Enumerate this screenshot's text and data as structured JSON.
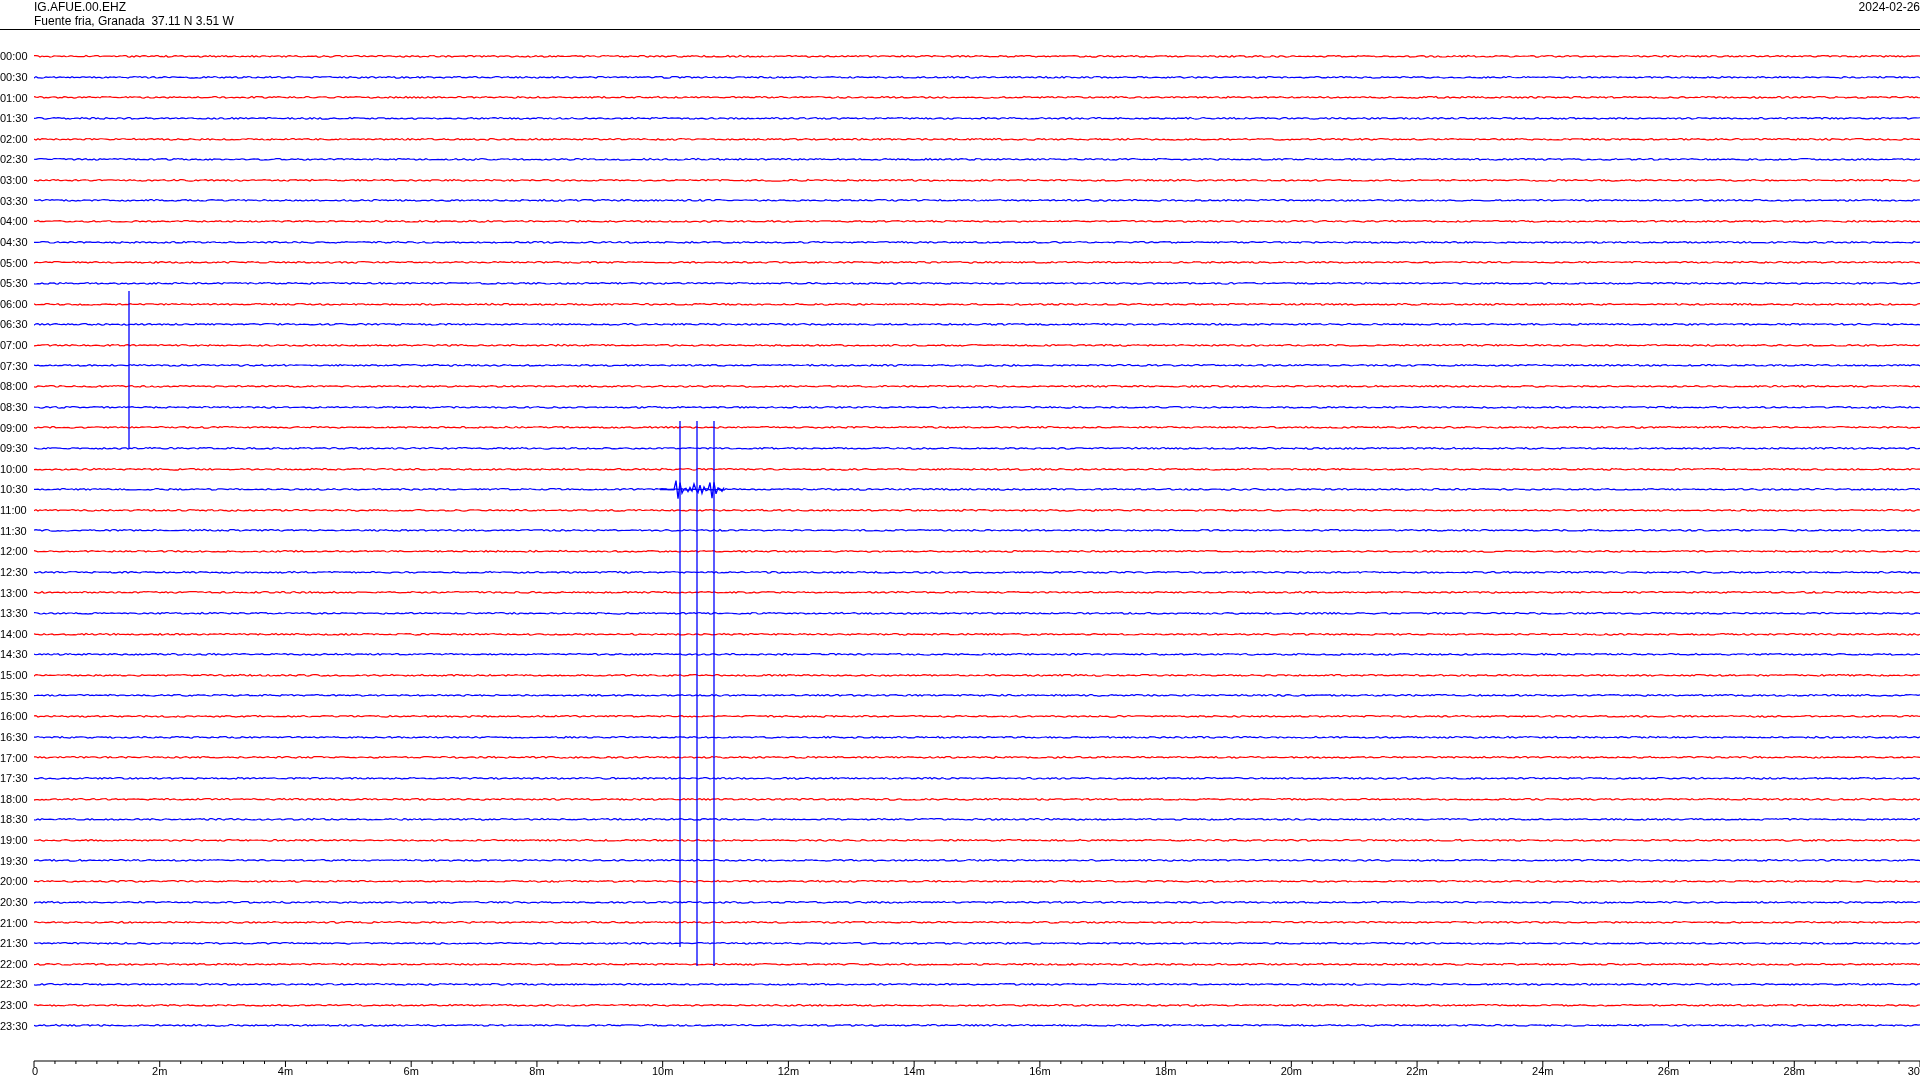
{
  "header": {
    "station": "IG.AFUE.00.EHZ",
    "location": "Fuente fria, Granada  37.11 N 3.51 W",
    "date": "2024-02-26"
  },
  "rows": [
    {
      "time": "00:00",
      "color": "#ff0000"
    },
    {
      "time": "00:30",
      "color": "#0000ff"
    },
    {
      "time": "01:00",
      "color": "#ff0000"
    },
    {
      "time": "01:30",
      "color": "#0000ff"
    },
    {
      "time": "02:00",
      "color": "#ff0000"
    },
    {
      "time": "02:30",
      "color": "#0000ff"
    },
    {
      "time": "03:00",
      "color": "#ff0000"
    },
    {
      "time": "03:30",
      "color": "#0000ff"
    },
    {
      "time": "04:00",
      "color": "#ff0000"
    },
    {
      "time": "04:30",
      "color": "#0000ff"
    },
    {
      "time": "05:00",
      "color": "#ff0000"
    },
    {
      "time": "05:30",
      "color": "#0000ff"
    },
    {
      "time": "06:00",
      "color": "#ff0000"
    },
    {
      "time": "06:30",
      "color": "#0000ff"
    },
    {
      "time": "07:00",
      "color": "#ff0000"
    },
    {
      "time": "07:30",
      "color": "#0000ff"
    },
    {
      "time": "08:00",
      "color": "#ff0000"
    },
    {
      "time": "08:30",
      "color": "#0000ff"
    },
    {
      "time": "09:00",
      "color": "#ff0000"
    },
    {
      "time": "09:30",
      "color": "#0000ff"
    },
    {
      "time": "10:00",
      "color": "#ff0000"
    },
    {
      "time": "10:30",
      "color": "#0000ff"
    },
    {
      "time": "11:00",
      "color": "#ff0000"
    },
    {
      "time": "11:30",
      "color": "#0000ff"
    },
    {
      "time": "12:00",
      "color": "#ff0000"
    },
    {
      "time": "12:30",
      "color": "#0000ff"
    },
    {
      "time": "13:00",
      "color": "#ff0000"
    },
    {
      "time": "13:30",
      "color": "#0000ff"
    },
    {
      "time": "14:00",
      "color": "#ff0000"
    },
    {
      "time": "14:30",
      "color": "#0000ff"
    },
    {
      "time": "15:00",
      "color": "#ff0000"
    },
    {
      "time": "15:30",
      "color": "#0000ff"
    },
    {
      "time": "16:00",
      "color": "#ff0000"
    },
    {
      "time": "16:30",
      "color": "#0000ff"
    },
    {
      "time": "17:00",
      "color": "#ff0000"
    },
    {
      "time": "17:30",
      "color": "#0000ff"
    },
    {
      "time": "18:00",
      "color": "#ff0000"
    },
    {
      "time": "18:30",
      "color": "#0000ff"
    },
    {
      "time": "19:00",
      "color": "#ff0000"
    },
    {
      "time": "19:30",
      "color": "#0000ff"
    },
    {
      "time": "20:00",
      "color": "#ff0000"
    },
    {
      "time": "20:30",
      "color": "#0000ff"
    },
    {
      "time": "21:00",
      "color": "#ff0000"
    },
    {
      "time": "21:30",
      "color": "#0000ff"
    },
    {
      "time": "22:00",
      "color": "#ff0000"
    },
    {
      "time": "22:30",
      "color": "#0000ff"
    },
    {
      "time": "23:00",
      "color": "#ff0000"
    },
    {
      "time": "23:30",
      "color": "#0000ff"
    }
  ],
  "axis": {
    "labels": [
      "0",
      "2m",
      "4m",
      "6m",
      "8m",
      "10m",
      "12m",
      "14m",
      "16m",
      "18m",
      "20m",
      "22m",
      "24m",
      "26m",
      "28m",
      "30"
    ]
  }
}
